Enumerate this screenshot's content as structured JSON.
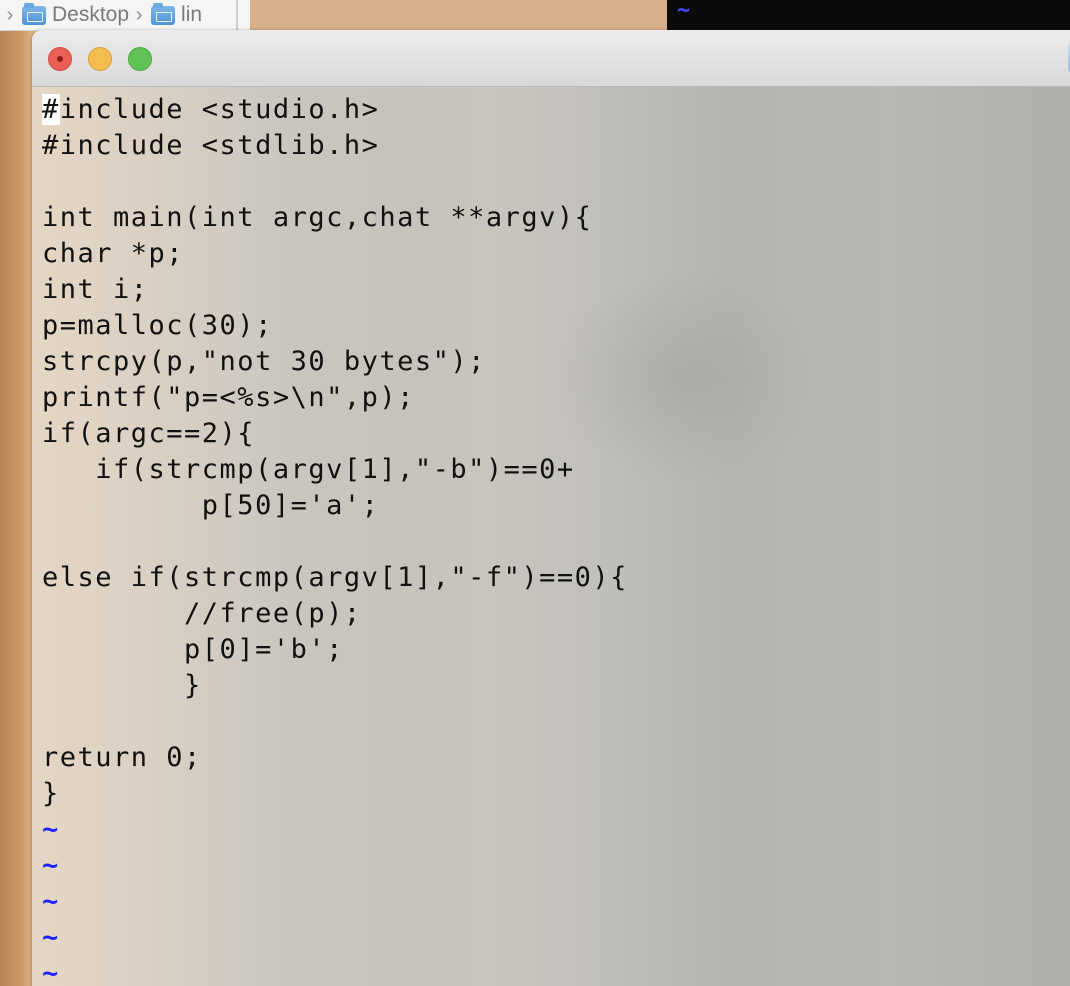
{
  "finder": {
    "breadcrumb": [
      {
        "label": "Desktop"
      },
      {
        "label": "lin"
      }
    ],
    "chevron": "›"
  },
  "background_terminal": {
    "tilde": "~"
  },
  "editor": {
    "cursor_char": "#",
    "first_line_rest": "include <studio.h>",
    "lines": [
      "#include <stdlib.h>",
      "",
      "int main(int argc,chat **argv){",
      "char *p;",
      "int i;",
      "p=malloc(30);",
      "strcpy(p,\"not 30 bytes\");",
      "printf(\"p=<%s>\\n\",p);",
      "if(argc==2){",
      "   if(strcmp(argv[1],\"-b\")==0+",
      "         p[50]='a';",
      "",
      "else if(strcmp(argv[1],\"-f\")==0){",
      "        //free(p);",
      "        p[0]='b';",
      "        }",
      "",
      "return 0;",
      "}"
    ],
    "empty_line_markers": [
      "~",
      "~",
      "~",
      "~",
      "~"
    ]
  },
  "colors": {
    "close": "#ec5f56",
    "minimize": "#f5bd4f",
    "maximize": "#5fc454",
    "tilde": "#1f1fff"
  }
}
